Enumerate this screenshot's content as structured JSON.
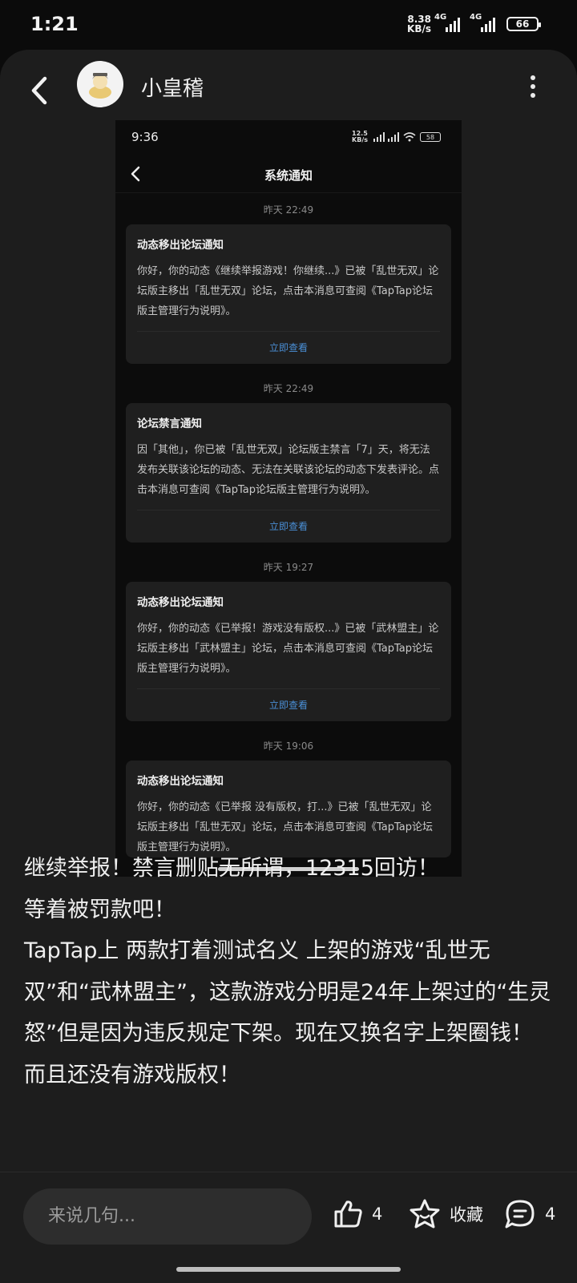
{
  "status_bar": {
    "time": "1:21",
    "speed_value": "8.38",
    "speed_unit": "KB/s",
    "net1": "4G",
    "net2": "4G",
    "battery": "66"
  },
  "header": {
    "author": "小皇稽"
  },
  "screenshot": {
    "status_time": "9:36",
    "status_speed_value": "12.5",
    "status_speed_unit": "KB/s",
    "status_battery": "58",
    "title": "系统通知",
    "notifications": [
      {
        "date": "昨天  22:49",
        "title": "动态移出论坛通知",
        "body": "你好，你的动态《继续举报游戏！你继续...》已被「乱世无双」论坛版主移出「乱世无双」论坛，点击本消息可查阅《TapTap论坛版主管理行为说明》。",
        "action": "立即查看"
      },
      {
        "date": "昨天  22:49",
        "title": "论坛禁言通知",
        "body": "因「其他」，你已被「乱世无双」论坛版主禁言「7」天，将无法发布关联该论坛的动态、无法在关联该论坛的动态下发表评论。点击本消息可查阅《TapTap论坛版主管理行为说明》。",
        "action": "立即查看"
      },
      {
        "date": "昨天  19:27",
        "title": "动态移出论坛通知",
        "body": "你好，你的动态《已举报！游戏没有版权...》已被「武林盟主」论坛版主移出「武林盟主」论坛，点击本消息可查阅《TapTap论坛版主管理行为说明》。",
        "action": "立即查看"
      },
      {
        "date": "昨天  19:06",
        "title": "动态移出论坛通知",
        "body": "你好，你的动态《已举报 没有版权，打...》已被「乱世无双」论坛版主移出「乱世无双」论坛，点击本消息可查阅《TapTap论坛版主管理行为说明》。",
        "action": ""
      }
    ]
  },
  "post": {
    "line1": "继续举报！禁言删贴无所谓，12315回访！",
    "line2": "等着被罚款吧！",
    "line3": "TapTap上 两款打着测试名义 上架的游戏“乱世无双”和“武林盟主”，这款游戏分明是24年上架过的“生灵怒”但是因为违反规定下架。现在又换名字上架圈钱！而且还没有游戏版权！"
  },
  "bottom_bar": {
    "comment_placeholder": "来说几句...",
    "like_count": "4",
    "favorite_label": "收藏",
    "comment_count": "4"
  }
}
